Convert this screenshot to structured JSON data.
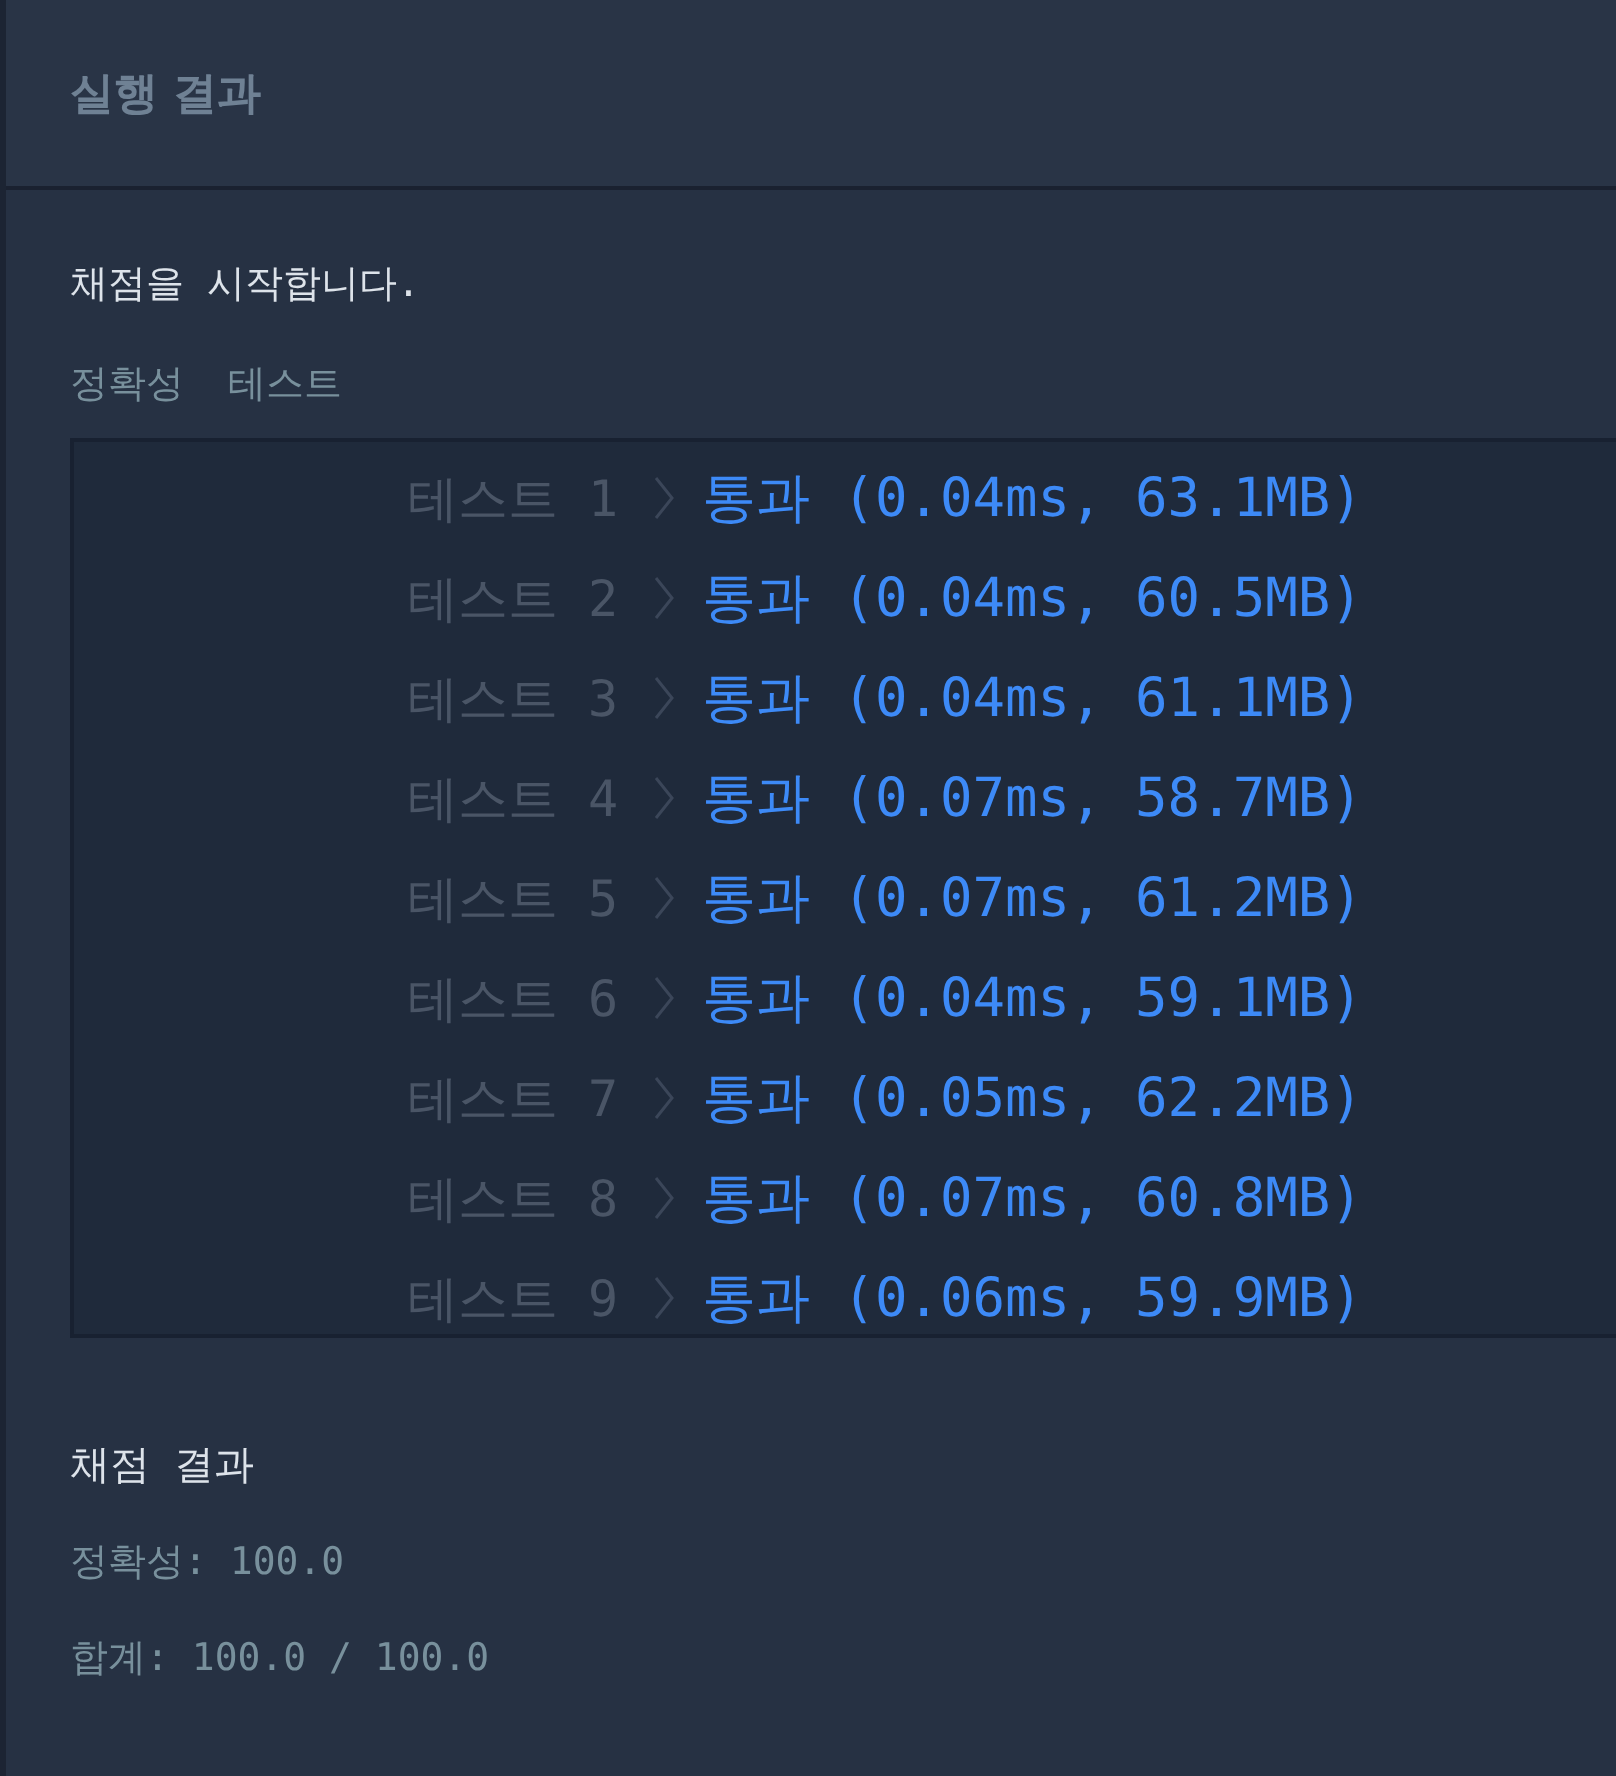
{
  "panel": {
    "title": "실행 결과"
  },
  "output": {
    "start_message": "채점을 시작합니다.",
    "group_label": "정확성 테스트",
    "tests": [
      {
        "label": "테스트 1",
        "result": "통과 (0.04ms, 63.1MB)",
        "passed": true
      },
      {
        "label": "테스트 2",
        "result": "통과 (0.04ms, 60.5MB)",
        "passed": true
      },
      {
        "label": "테스트 3",
        "result": "통과 (0.04ms, 61.1MB)",
        "passed": true
      },
      {
        "label": "테스트 4",
        "result": "통과 (0.07ms, 58.7MB)",
        "passed": true
      },
      {
        "label": "테스트 5",
        "result": "통과 (0.07ms, 61.2MB)",
        "passed": true
      },
      {
        "label": "테스트 6",
        "result": "통과 (0.04ms, 59.1MB)",
        "passed": true
      },
      {
        "label": "테스트 7",
        "result": "통과 (0.05ms, 62.2MB)",
        "passed": true
      },
      {
        "label": "테스트 8",
        "result": "통과 (0.07ms, 60.8MB)",
        "passed": true
      },
      {
        "label": "테스트 9",
        "result": "통과 (0.06ms, 59.9MB)",
        "passed": true
      }
    ],
    "summary_title": "채점 결과",
    "summary_lines": [
      "정확성: 100.0",
      "합계: 100.0 / 100.0"
    ]
  }
}
